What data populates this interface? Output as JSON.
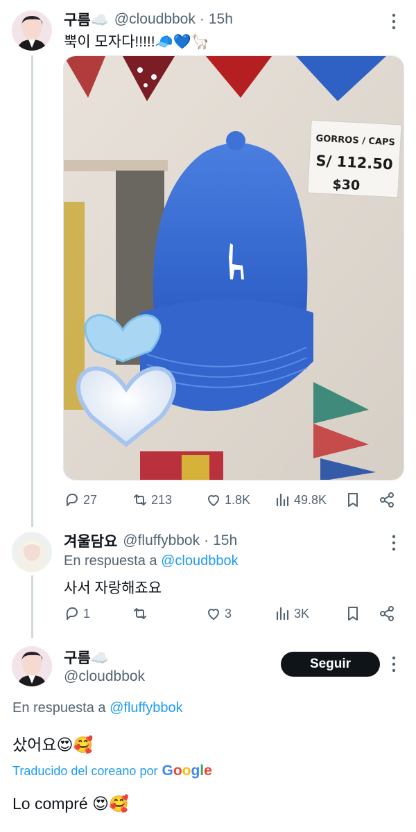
{
  "tweet1": {
    "display_name": "구름☁️",
    "handle": "@cloudbbok",
    "dot": "·",
    "time": "15h",
    "text": "뿍이 모자다!!!!!🧢💙🦙",
    "sign_gorros": "GORROS / CAPS",
    "sign_price1": "S/ 112.50",
    "sign_price2": "$30",
    "stats": {
      "replies": "27",
      "retweets": "213",
      "likes": "1.8K",
      "views": "49.8K"
    }
  },
  "tweet2": {
    "display_name": "겨울담요",
    "handle": "@fluffybbok",
    "dot": "·",
    "time": "15h",
    "reply_prefix": "En respuesta a",
    "reply_handle": "@cloudbbok",
    "text": "사서 자랑해죠요",
    "stats": {
      "replies": "1",
      "retweets": "",
      "likes": "3",
      "views": "3K"
    }
  },
  "tweet3": {
    "display_name": "구름☁️",
    "handle": "@cloudbbok",
    "follow_label": "Seguir",
    "reply_prefix": "En respuesta a",
    "reply_handle": "@fluffybbok",
    "text": "샀어요😍🥰",
    "translated_label": "Traducido del coreano por",
    "translated_text": "Lo compré 😍🥰"
  },
  "colors": {
    "accent": "#1d9bf0",
    "text": "#0f1419",
    "muted": "#536471",
    "cap": "#3a6fd6"
  },
  "icons": [
    "more-icon",
    "reply-icon",
    "retweet-icon",
    "like-icon",
    "views-icon",
    "bookmark-icon",
    "share-icon",
    "google-logo"
  ]
}
